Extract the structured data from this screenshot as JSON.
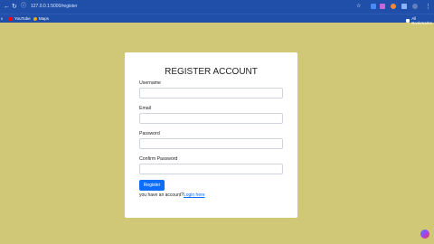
{
  "browser": {
    "url": "127.0.0.1:5000/register",
    "bookmarks": [
      {
        "label": "YouTube"
      },
      {
        "label": "Maps"
      }
    ],
    "all_bookmarks_label": "All Bookmarks"
  },
  "form": {
    "title": "REGISTER ACCOUNT",
    "fields": [
      {
        "label": "Username",
        "value": ""
      },
      {
        "label": "Email",
        "value": ""
      },
      {
        "label": "Password",
        "value": ""
      },
      {
        "label": "Confirm Password",
        "value": ""
      }
    ],
    "submit_label": "Register",
    "footer_text": "you have an account?",
    "login_link": "Login here"
  },
  "colors": {
    "background": "#d1c877",
    "browser_bar": "#1f4fa8",
    "primary_button": "#0d6efd"
  }
}
